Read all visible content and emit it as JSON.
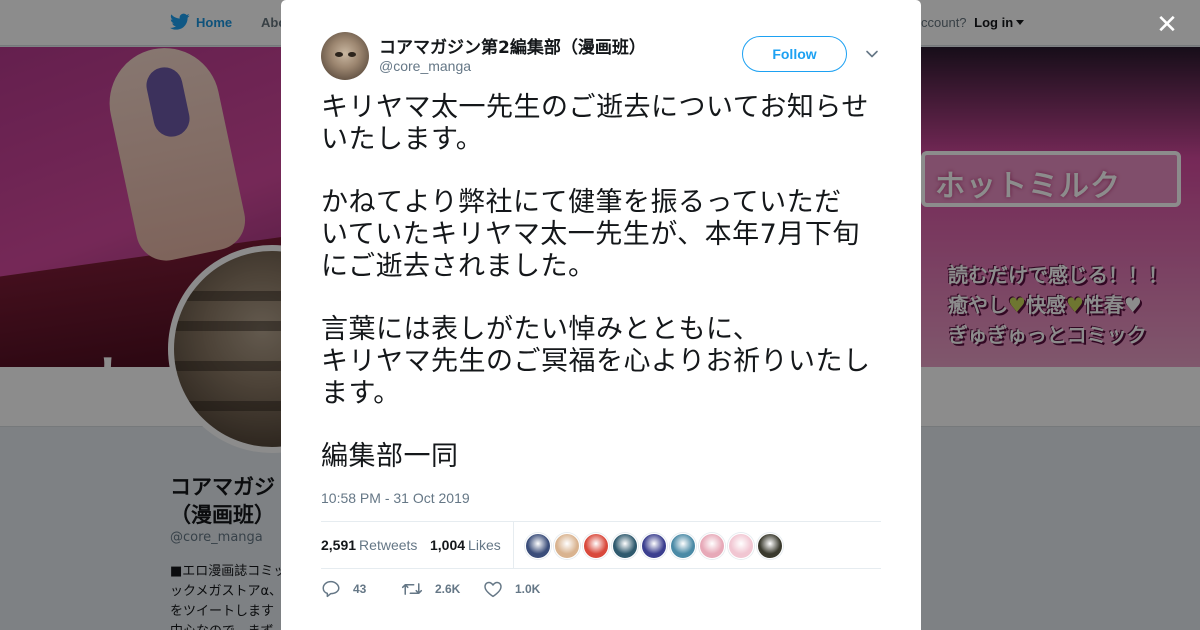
{
  "nav": {
    "home_label": "Home",
    "about_label": "Abo",
    "account_prompt": "ccount?",
    "login_label": "Log in"
  },
  "banner": {
    "title_text": "ホットミルク",
    "catch_line1": "読むだけで感じる！！！",
    "catch_line2_a": "癒やし",
    "catch_line2_b": "快感",
    "catch_line2_c": "性春",
    "catch_line3": "ぎゅぎゅっとコミック",
    "heart_glyph": "♥",
    "left_kanji": "カ"
  },
  "profile": {
    "name_line1": "コアマガジ",
    "name_line2": "（漫画班）",
    "handle": "@core_manga",
    "bio_line1": "■エロ漫画誌コミッ",
    "bio_line2": "ックメガストアα、",
    "bio_line3": "をツイートします",
    "bio_line4": "中心なので、まず"
  },
  "modal": {
    "close_glyph": "✕",
    "author_name": "コアマガジン第2編集部（漫画班）",
    "author_handle": "@core_manga",
    "follow_label": "Follow",
    "tweet_p1": "キリヤマ太一先生のご逝去についてお知らせ\nいたします。",
    "tweet_p2": "かねてより弊社にて健筆を振るっていただ\nいていたキリヤマ太一先生が、本年7月下旬\nにご逝去されました。",
    "tweet_p3": "言葉には表しがたい悼みとともに、\nキリヤマ先生のご冥福を心よりお祈りいたし\nます。",
    "tweet_p4": "編集部一同",
    "timestamp": "10:58 PM - 31 Oct 2019",
    "retweets_count": "2,591",
    "retweets_label": "Retweets",
    "likes_count": "1,004",
    "likes_label": "Likes",
    "reply_count": "43",
    "retweet_action_count": "2.6K",
    "like_action_count": "1.0K"
  },
  "colors": {
    "accent": "#1da1f2",
    "muted_text": "#657786",
    "text": "#14171a",
    "liker_avatars": [
      "#3a4d7a",
      "#d9b38f",
      "#d9493c",
      "#2f5a6e",
      "#3b3f8f",
      "#4a8aa6",
      "#e7a9b8",
      "#f1c6d2",
      "#3a3a2e"
    ]
  },
  "icons": {
    "bird": "twitter-bird-icon",
    "close": "close-icon",
    "chevron": "chevron-down-icon",
    "reply": "reply-icon",
    "retweet": "retweet-icon",
    "like": "heart-icon"
  }
}
